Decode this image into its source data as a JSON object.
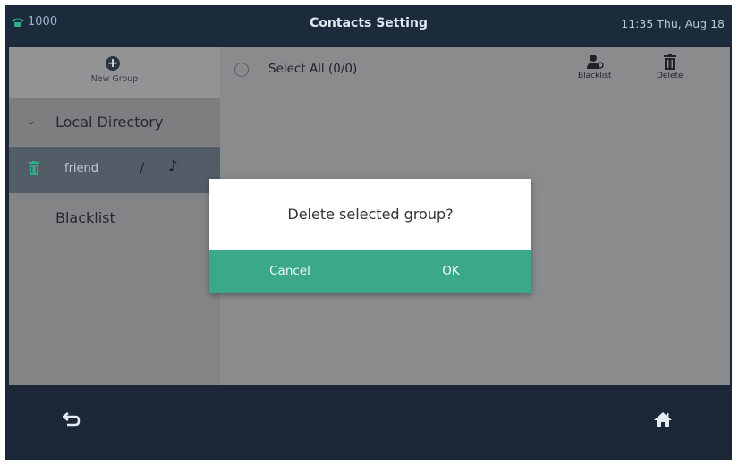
{
  "header": {
    "extension": "1000",
    "title": "Contacts Setting",
    "clock": "11:35 Thu, Aug 18",
    "phone_icon": "phone-icon"
  },
  "sidebar": {
    "new_group_label": "New Group",
    "items": [
      {
        "label": "Local Directory",
        "icon": "chevron-down-icon"
      },
      {
        "label": "friend",
        "icon": "trash-icon",
        "selected": true
      },
      {
        "label": "Blacklist"
      }
    ]
  },
  "main": {
    "select_all_label": "Select All (0/0)",
    "toolbar": {
      "blacklist_label": "Blacklist",
      "delete_label": "Delete"
    }
  },
  "dialog": {
    "message": "Delete selected group?",
    "cancel_label": "Cancel",
    "ok_label": "OK",
    "button_color": "#3aa889"
  },
  "footer": {
    "back_icon": "back-icon",
    "home_icon": "home-icon"
  }
}
